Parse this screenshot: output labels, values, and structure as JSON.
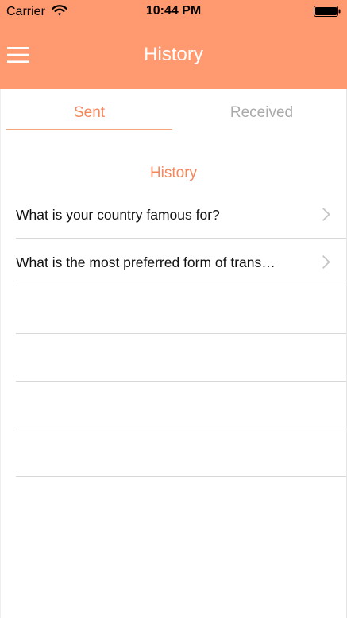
{
  "status_bar": {
    "carrier": "Carrier",
    "time": "10:44 PM",
    "wifi_icon": "wifi-icon",
    "battery_icon": "battery-icon"
  },
  "nav_bar": {
    "title": "History",
    "menu_icon": "hamburger-menu-icon",
    "background_color": "#FF9A70"
  },
  "tabs": {
    "sent": "Sent",
    "received": "Received",
    "active": "Sent",
    "active_color": "#F5875B",
    "inactive_color": "#A9A9A9"
  },
  "section": {
    "title": "History"
  },
  "list": {
    "items": [
      {
        "label": "What is your country famous for?"
      },
      {
        "label": "What is the most preferred form of trans…"
      },
      {
        "label": ""
      },
      {
        "label": ""
      },
      {
        "label": ""
      },
      {
        "label": ""
      },
      {
        "label": ""
      }
    ]
  }
}
